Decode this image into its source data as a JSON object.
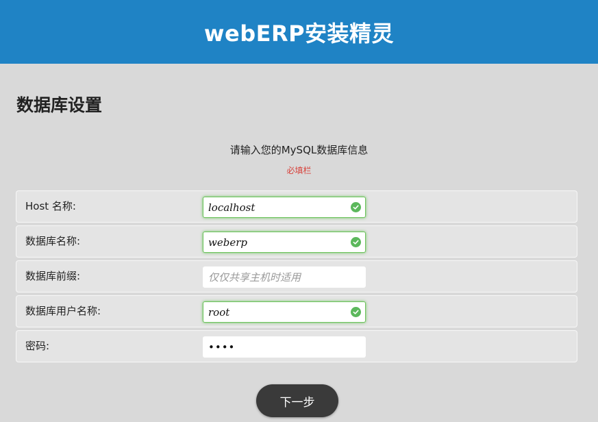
{
  "header": {
    "title": "webERP安装精灵"
  },
  "section": {
    "title": "数据库设置"
  },
  "intro": {
    "text": "请输入您的MySQL数据库信息",
    "required_note": "必填栏"
  },
  "fields": [
    {
      "label": "Host 名称:",
      "value": "localhost",
      "placeholder": "",
      "valid": true
    },
    {
      "label": "数据库名称:",
      "value": "weberp",
      "placeholder": "",
      "valid": true
    },
    {
      "label": "数据库前缀:",
      "value": "",
      "placeholder": "仅仅共享主机时适用",
      "valid": false
    },
    {
      "label": "数据库用户名称:",
      "value": "root",
      "placeholder": "",
      "valid": true
    },
    {
      "label": "密码:",
      "value": "abcd",
      "placeholder": "",
      "valid": false
    }
  ],
  "actions": {
    "next_label": "下一步"
  },
  "colors": {
    "header_bg": "#1f83c5",
    "page_bg": "#d9d9d9",
    "required": "#d8413a",
    "valid": "#5cb85c",
    "button_bg": "#3a3a3a"
  },
  "icons": {
    "valid": "check-circle-icon"
  }
}
